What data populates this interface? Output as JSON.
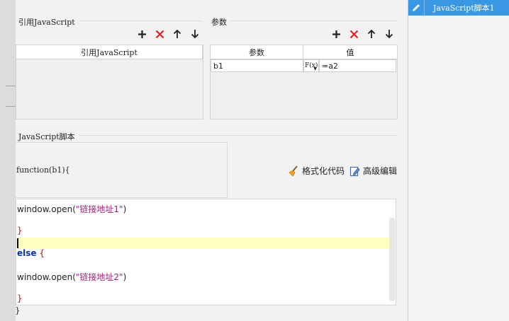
{
  "references": {
    "title": "引用JavaScript",
    "column_header": "引用JavaScript",
    "items": []
  },
  "params": {
    "title": "参数",
    "headers": {
      "name": "参数",
      "value": "值"
    },
    "rows": [
      {
        "name": "b1",
        "formula_icon": "F(x)",
        "value": "=a2"
      }
    ]
  },
  "script": {
    "title": "JavaScript脚本",
    "function_signature": "function(b1){",
    "format_label": "格式化代码",
    "advanced_label": "高级编辑",
    "code": {
      "l1_call": "window.open(",
      "l1_str": "\"链接地址1\"",
      "l1_end": ")",
      "l2_brace": "}",
      "l4_kw": "else",
      "l4_brace": " {",
      "l5_call": "window.open(",
      "l5_str": "\"链接地址2\"",
      "l5_end": ")",
      "l6_brace": "}"
    },
    "closing_brace": "}"
  },
  "side_panel": {
    "tab_label": "JavaScript脚本1"
  },
  "colors": {
    "accent": "#3a97e4",
    "delete_red": "#e02020",
    "keyword_blue": "#0a2fa8",
    "string_magenta": "#a11f7e",
    "highlight_line": "#ffffc0"
  },
  "icons": {
    "add": "plus-icon",
    "delete": "x-icon",
    "up": "arrow-up-icon",
    "down": "arrow-down-icon",
    "format": "broom-icon",
    "advanced": "edit-document-icon",
    "tab": "pencil-icon"
  }
}
